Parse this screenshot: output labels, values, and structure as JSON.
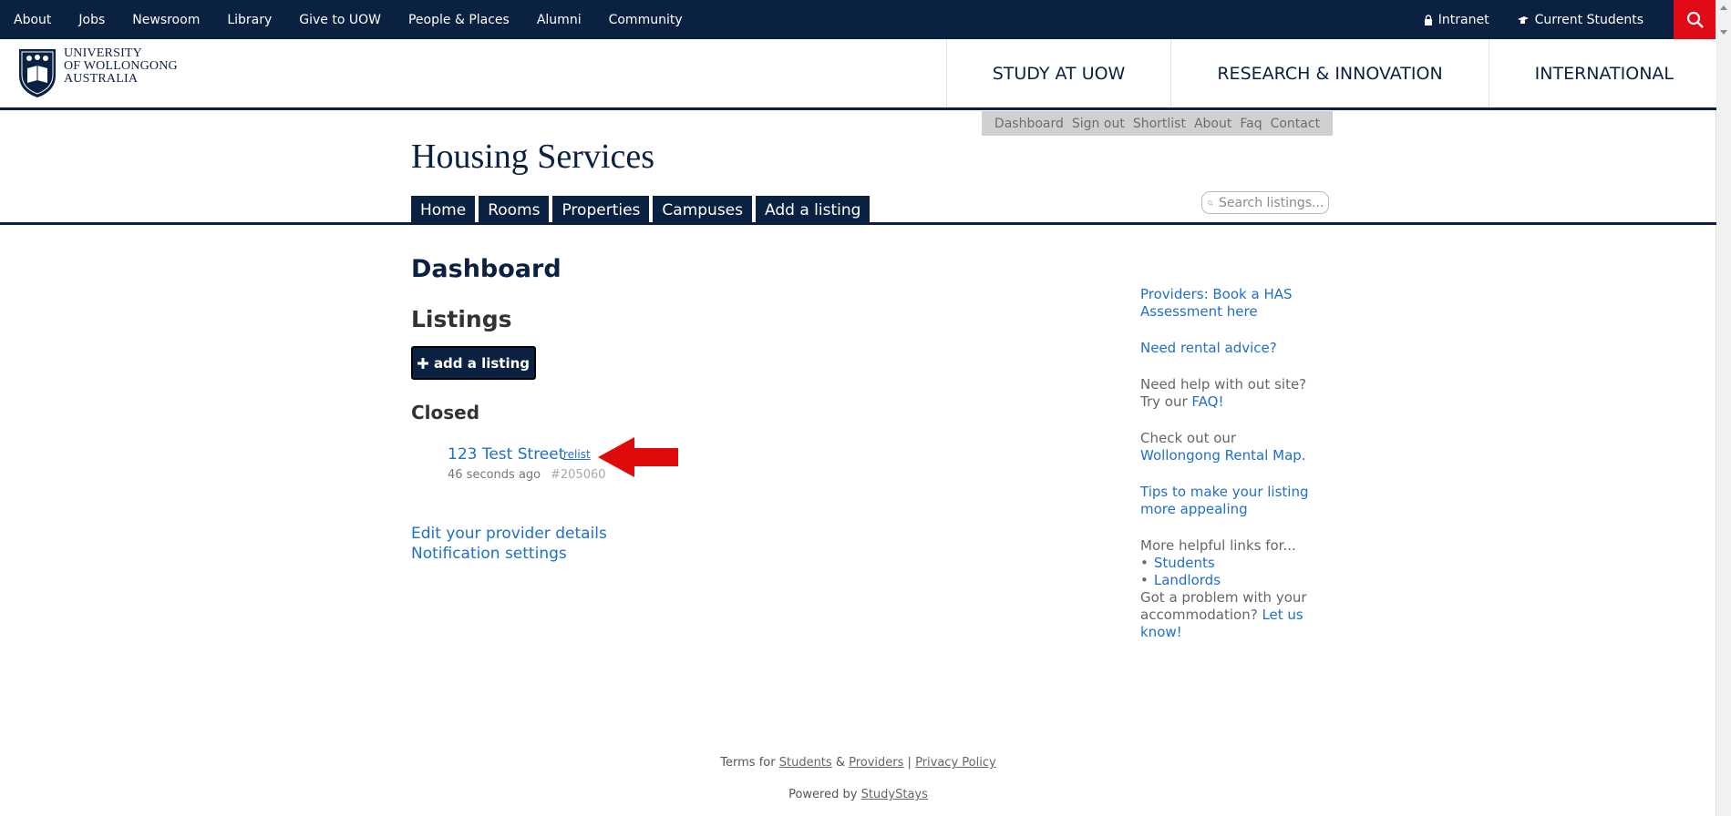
{
  "topbar": {
    "links": [
      "About",
      "Jobs",
      "Newsroom",
      "Library",
      "Give to UOW",
      "People & Places",
      "Alumni",
      "Community"
    ],
    "intranet": "Intranet",
    "current_students": "Current Students",
    "color": "#0b2141",
    "search_color": "#e10a17"
  },
  "logo": {
    "line1": "UNIVERSITY",
    "line2": "OF WOLLONGONG",
    "line3": "AUSTRALIA"
  },
  "mainnav": [
    "STUDY AT UOW",
    "RESEARCH & INNOVATION",
    "INTERNATIONAL"
  ],
  "housing": {
    "minibar": [
      "Dashboard",
      "Sign out",
      "Shortlist",
      "About",
      "Faq",
      "Contact"
    ],
    "title": "Housing Services",
    "tabs": [
      "Home",
      "Rooms",
      "Properties",
      "Campuses",
      "Add a listing"
    ],
    "search_placeholder": "Search listings..."
  },
  "main": {
    "dashboard_heading": "Dashboard",
    "listings_heading": "Listings",
    "add_button": "add a listing",
    "closed_heading": "Closed",
    "listing": {
      "title": "123 Test Street",
      "relist": "relist",
      "time": "46 seconds ago",
      "id": "#205060"
    },
    "edit_provider": "Edit your provider details",
    "notification_settings": "Notification settings"
  },
  "sidebar": {
    "book_has": "Providers: Book a HAS Assessment here",
    "rental_advice": "Need rental advice?",
    "help_prefix": "Need help with out site? Try our",
    "faq": "FAQ!",
    "check_out": "Check out our",
    "rental_map": "Wollongong Rental Map.",
    "tips": "Tips to make your listing more appealing",
    "more_links": "More helpful links for...",
    "students": "Students",
    "landlords": "Landlords",
    "problem": "Got a problem with your accommodation?",
    "let_us_know": "Let us know!"
  },
  "footer": {
    "terms_for": "Terms for",
    "students": "Students",
    "amp": "&",
    "providers": "Providers",
    "pipe": "|",
    "privacy": "Privacy Policy",
    "powered_by": "Powered by",
    "studystays": "StudyStays"
  }
}
